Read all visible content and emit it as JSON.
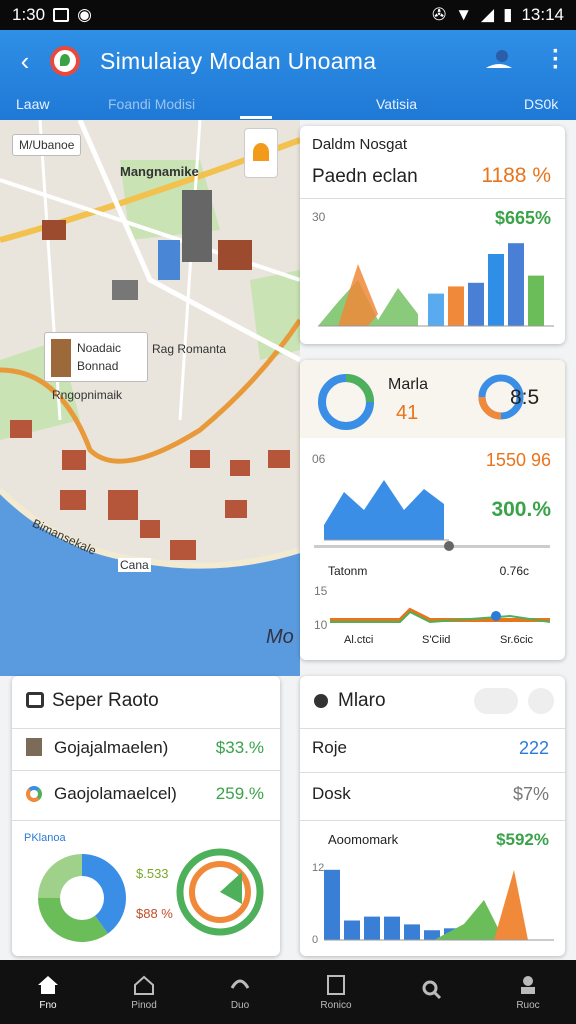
{
  "status": {
    "time": "1:30",
    "clock": "13:14"
  },
  "appbar": {
    "title": "Simulaiay Modan Unoama",
    "tabs": [
      {
        "label": "Laaw"
      },
      {
        "label": "Foandi Modisi"
      },
      {
        "label": "Vatisia"
      },
      {
        "label": "DS0k"
      }
    ]
  },
  "map": {
    "labels": {
      "top": "M/Ubanoe",
      "district": "Mangnamike",
      "card1": "Noadaic",
      "card2": "Bonnad",
      "card3": "Rngopnimaik",
      "tag": "Rag Romanta",
      "coast": "Bimansekale",
      "pier": "Cana",
      "water": "Mo"
    },
    "colors": {
      "water": "#5a9be0",
      "land": "#e6e2d9",
      "park": "#c9e3b4"
    }
  },
  "cards": {
    "top_right": {
      "title": "Daldm Nosgat",
      "subtitle": "Paedn eclan",
      "pct": "1188 %",
      "axis": "30",
      "pct2": "$665%"
    },
    "mid_right": {
      "title": "Marla",
      "value": "41",
      "value2": "8:5",
      "axis": "06",
      "pct": "1550 96",
      "pct2": "300.%",
      "label1": "Tatonm",
      "label2": "0.76c",
      "axis2": "15",
      "axis3": "10",
      "x1": "Al.ctci",
      "x2": "S'Ciid",
      "x3": "Sr.6cic"
    },
    "bottom_left": {
      "title": "Seper Raoto",
      "row1": "Gojajalmaelen)",
      "row1_val": "$33.%",
      "row2": "Gaojolamaelcel)",
      "row2_val": "259.%",
      "legend": "PKlanoa",
      "pie_val1": "$.533",
      "pie_val2": "$88 %"
    },
    "bottom_right": {
      "title": "Mlaro",
      "row1": "Roje",
      "row1_val": "222",
      "row2": "Dosk",
      "row2_val": "$7%",
      "chart_label": "Aoomomark",
      "chart_val": "$592%",
      "axis1": "12",
      "axis2": "0"
    }
  },
  "nav": [
    {
      "label": "Fno"
    },
    {
      "label": "Pinod"
    },
    {
      "label": "Duo"
    },
    {
      "label": "Ronico"
    },
    {
      "label": ""
    },
    {
      "label": "Ruoc"
    }
  ],
  "chart_data": [
    {
      "type": "bar",
      "values": [
        18,
        22,
        24,
        40,
        46,
        28
      ],
      "colors": [
        "#5aaaf0",
        "#f08a3a",
        "#4a7fd6",
        "#2f8fe6",
        "#4a7fd6",
        "#6bbd5a"
      ]
    },
    {
      "type": "area",
      "values": [
        10,
        32,
        20,
        40,
        20,
        34,
        24
      ]
    },
    {
      "type": "pie",
      "values": [
        40,
        35,
        25
      ]
    },
    {
      "type": "bar",
      "values": [
        36,
        10,
        12,
        12,
        8,
        5,
        6
      ]
    }
  ]
}
